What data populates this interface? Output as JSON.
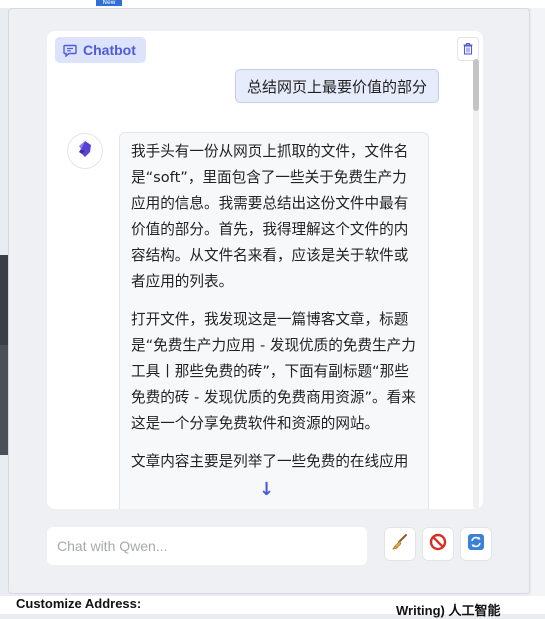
{
  "background": {
    "new_badge": "New",
    "bottom_left_text": "Customize Address:",
    "bottom_right_text": "Writing) 人工智能"
  },
  "chatbot": {
    "tag_label": "Chatbot",
    "tag_icon": "chat-bubble-icon",
    "clear_icon": "trash-icon",
    "accent_color": "#4f5bd5"
  },
  "messages": {
    "user": "总结网页上最要价值的部分",
    "bot_paragraphs": [
      "我手头有一份从网页上抓取的文件，文件名是“soft”，里面包含了一些关于免费生产力应用的信息。我需要总结出这份文件中最有价值的部分。首先，我得理解这个文件的内容结构。从文件名来看，应该是关于软件或者应用的列表。",
      "打开文件，我发现这是一篇博客文章，标题是“免费生产力应用 - 发现优质的免费生产力工具丨那些免费的砖”，下面有副标题“那些免费的砖 - 发现优质的免费商用资源”。看来这是一个分享免费软件和资源的网站。",
      "文章内容主要是列举了一些免费的在线应用"
    ],
    "scroll_down_icon": "arrow-down-icon"
  },
  "input": {
    "placeholder": "Chat with Qwen...",
    "value": ""
  },
  "actions": {
    "clear_icon": "broom-icon",
    "stop_icon": "stop-icon",
    "regenerate_icon": "refresh-icon"
  }
}
